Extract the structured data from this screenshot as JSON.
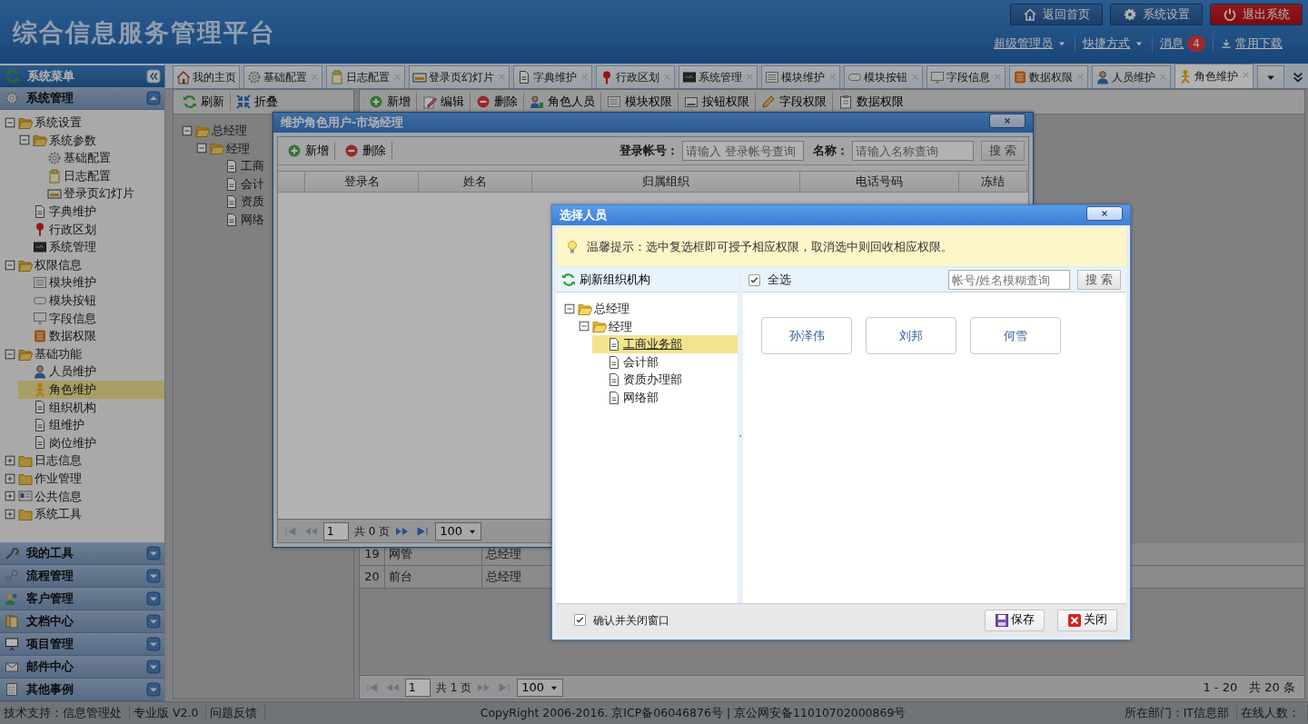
{
  "header": {
    "title": "综合信息服务管理平台",
    "buttons": [
      {
        "label": "返回首页",
        "kind": "home"
      },
      {
        "label": "系统设置",
        "kind": "settings"
      },
      {
        "label": "退出系统",
        "kind": "logout"
      }
    ],
    "links": [
      {
        "label": "超级管理员",
        "kind": "dropdown"
      },
      {
        "label": "快捷方式",
        "kind": "dropdown"
      },
      {
        "label": "消息",
        "kind": "badge",
        "badge": "4"
      },
      {
        "label": "常用下载",
        "kind": "download"
      }
    ]
  },
  "sidebar": {
    "title": "系统菜单",
    "panels": [
      {
        "label": "系统管理",
        "expanded": true,
        "tree": [
          {
            "label": "系统设置",
            "kind": "folder",
            "expanded": true,
            "selected": false,
            "children": [
              {
                "label": "系统参数",
                "kind": "folder",
                "expanded": true,
                "selected": false,
                "children": [
                  {
                    "label": "基础配置",
                    "kind": "item",
                    "selected": false
                  },
                  {
                    "label": "日志配置",
                    "kind": "item",
                    "selected": false
                  },
                  {
                    "label": "登录页幻灯片",
                    "kind": "item",
                    "selected": false
                  }
                ]
              },
              {
                "label": "字典维护",
                "kind": "item",
                "selected": false
              },
              {
                "label": "行政区划",
                "kind": "item",
                "selected": false
              },
              {
                "label": "系统管理",
                "kind": "item",
                "selected": false
              }
            ]
          },
          {
            "label": "权限信息",
            "kind": "folder",
            "expanded": true,
            "selected": false,
            "children": [
              {
                "label": "模块维护",
                "kind": "item",
                "selected": false
              },
              {
                "label": "模块按钮",
                "kind": "item",
                "selected": false
              },
              {
                "label": "字段信息",
                "kind": "item",
                "selected": false
              },
              {
                "label": "数据权限",
                "kind": "item",
                "selected": false
              }
            ]
          },
          {
            "label": "基础功能",
            "kind": "folder",
            "expanded": true,
            "selected": false,
            "children": [
              {
                "label": "人员维护",
                "kind": "item",
                "selected": false
              },
              {
                "label": "角色维护",
                "kind": "item",
                "selected": true
              },
              {
                "label": "组织机构",
                "kind": "item",
                "selected": false
              },
              {
                "label": "组维护",
                "kind": "item",
                "selected": false
              },
              {
                "label": "岗位维护",
                "kind": "item",
                "selected": false
              }
            ]
          },
          {
            "label": "日志信息",
            "kind": "folder",
            "expanded": false,
            "selected": false
          },
          {
            "label": "作业管理",
            "kind": "folder",
            "expanded": false,
            "selected": false
          },
          {
            "label": "公共信息",
            "kind": "folder",
            "expanded": false,
            "selected": false
          },
          {
            "label": "系统工具",
            "kind": "folder",
            "expanded": false,
            "selected": false
          }
        ]
      },
      {
        "label": "我的工具",
        "expanded": false
      },
      {
        "label": "流程管理",
        "expanded": false
      },
      {
        "label": "客户管理",
        "expanded": false
      },
      {
        "label": "文档中心",
        "expanded": false
      },
      {
        "label": "项目管理",
        "expanded": false
      },
      {
        "label": "邮件中心",
        "expanded": false
      },
      {
        "label": "其他事例",
        "expanded": false
      }
    ]
  },
  "tabs": [
    {
      "label": "我的主页",
      "selected": false,
      "closable": false
    },
    {
      "label": "基础配置",
      "selected": false,
      "closable": true
    },
    {
      "label": "日志配置",
      "selected": false,
      "closable": true
    },
    {
      "label": "登录页幻灯片",
      "selected": false,
      "closable": true
    },
    {
      "label": "字典维护",
      "selected": false,
      "closable": true
    },
    {
      "label": "行政区划",
      "selected": false,
      "closable": true
    },
    {
      "label": "系统管理",
      "selected": false,
      "closable": true
    },
    {
      "label": "模块维护",
      "selected": false,
      "closable": true
    },
    {
      "label": "模块按钮",
      "selected": false,
      "closable": true
    },
    {
      "label": "字段信息",
      "selected": false,
      "closable": true
    },
    {
      "label": "数据权限",
      "selected": false,
      "closable": true
    },
    {
      "label": "人员维护",
      "selected": false,
      "closable": true
    },
    {
      "label": "角色维护",
      "selected": true,
      "closable": true
    }
  ],
  "tree_panel": {
    "buttons": [
      "刷新",
      "折叠"
    ],
    "tree": [
      {
        "label": "总经理",
        "kind": "folder",
        "expanded": true,
        "selected": false,
        "children": [
          {
            "label": "经理",
            "kind": "folder",
            "expanded": true,
            "selected": false,
            "children": [
              {
                "label": "工商",
                "kind": "item",
                "selected": false
              },
              {
                "label": "会计",
                "kind": "item",
                "selected": false
              },
              {
                "label": "资质",
                "kind": "item",
                "selected": false
              },
              {
                "label": "网络",
                "kind": "item",
                "selected": false
              }
            ]
          }
        ]
      }
    ]
  },
  "main_panel": {
    "toolbar": [
      "新增",
      "编辑",
      "删除",
      "角色人员",
      "模块权限",
      "按钮权限",
      "字段权限",
      "数据权限"
    ],
    "rows": [
      {
        "cells": [
          "19",
          "网管",
          "总经理"
        ]
      },
      {
        "cells": [
          "20",
          "前台",
          "总经理"
        ]
      }
    ],
    "pager": {
      "page": "1",
      "total": "共 1 页",
      "size": "100",
      "summary": "1 - 20　共 20 条"
    }
  },
  "role_dialog": {
    "title": "维护角色用户-市场经理",
    "toolbar": [
      "新增",
      "删除"
    ],
    "filters": [
      {
        "label": "登录帐号：",
        "placeholder": "请输入 登录帐号查询"
      },
      {
        "label": "名称：",
        "placeholder": "请输入名称查询"
      }
    ],
    "search": "搜 索",
    "columns": [
      "登录名",
      "姓名",
      "归属组织",
      "电话号码",
      "冻结"
    ],
    "pager": {
      "page": "1",
      "total": "共 0 页",
      "size": "100"
    }
  },
  "select_dialog": {
    "title": "选择人员",
    "tip": "温馨提示：选中复选框即可授予相应权限，取消选中则回收相应权限。",
    "refresh": "刷新组织机构",
    "tree": [
      {
        "label": "总经理",
        "kind": "folder",
        "expanded": true,
        "selected": false,
        "children": [
          {
            "label": "经理",
            "kind": "folder",
            "expanded": true,
            "selected": false,
            "children": [
              {
                "label": "工商业务部",
                "kind": "item",
                "selected": true
              },
              {
                "label": "会计部",
                "kind": "item",
                "selected": false
              },
              {
                "label": "资质办理部",
                "kind": "item",
                "selected": false
              },
              {
                "label": "网络部",
                "kind": "item",
                "selected": false
              }
            ]
          }
        ]
      }
    ],
    "select_all": {
      "label": "全选",
      "checked": true
    },
    "search": {
      "placeholder": "帐号/姓名模糊查询",
      "button": "搜 索"
    },
    "people": [
      "孙泽伟",
      "刘邦",
      "何雪"
    ],
    "confirm": {
      "label": "确认并关闭窗口",
      "checked": true
    },
    "buttons": [
      {
        "label": "保存",
        "kind": "save"
      },
      {
        "label": "关闭",
        "kind": "close"
      }
    ]
  },
  "status_bar": {
    "left": [
      "技术支持：信息管理处",
      "专业版 V2.0",
      "问题反馈"
    ],
    "center": "CopyRight 2006-2016. 京ICP备06046876号 | 京公网安备11010702000869号",
    "right": [
      "所在部门：IT信息部",
      "在线人数："
    ]
  }
}
